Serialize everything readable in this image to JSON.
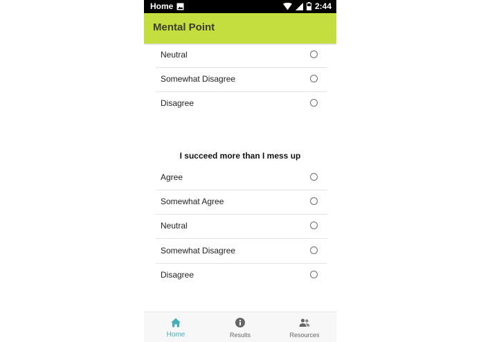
{
  "status_bar": {
    "left_label": "Home",
    "time": "2:44"
  },
  "app_bar": {
    "title": "Mental Point"
  },
  "question1_options": [
    {
      "label": "Neutral"
    },
    {
      "label": "Somewhat Disagree"
    },
    {
      "label": "Disagree"
    }
  ],
  "question2": {
    "text": "I succeed more than I mess up",
    "options": [
      {
        "label": "Agree"
      },
      {
        "label": "Somewhat Agree"
      },
      {
        "label": "Neutral"
      },
      {
        "label": "Somewhat Disagree"
      },
      {
        "label": "Disagree"
      }
    ]
  },
  "bottom_nav": {
    "items": [
      {
        "label": "Home",
        "icon": "home-icon",
        "active": true
      },
      {
        "label": "Results",
        "icon": "info-icon",
        "active": false
      },
      {
        "label": "Resources",
        "icon": "people-icon",
        "active": false
      }
    ]
  },
  "colors": {
    "app_bar": "#c4dd3f",
    "accent": "#46aeb8"
  }
}
